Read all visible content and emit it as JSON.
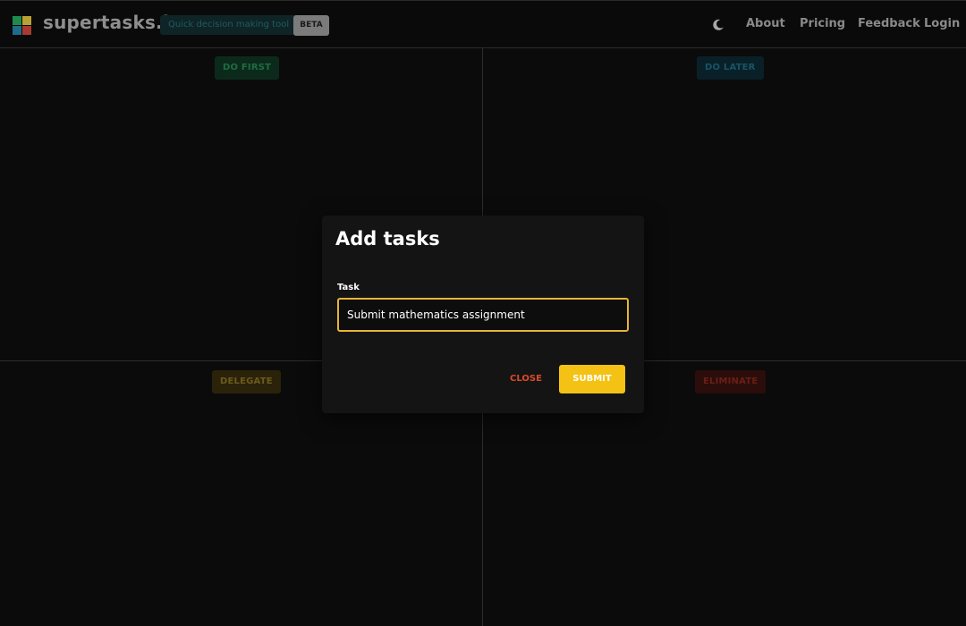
{
  "header": {
    "brand": "supertasks.io",
    "tagline": "Quick decision making tool",
    "beta_label": "BETA",
    "theme_icon": "moon-icon",
    "nav": {
      "about": "About",
      "pricing": "Pricing",
      "feedback": "Feedback",
      "login": "Login"
    },
    "logo_colors": [
      "#1f8a4e",
      "#b9a233",
      "#1f6b8a",
      "#a83b2f"
    ]
  },
  "quadrants": {
    "do_first": "DO FIRST",
    "do_later": "DO LATER",
    "delegate": "DELEGATE",
    "eliminate": "ELIMINATE"
  },
  "modal": {
    "title": "Add tasks",
    "task_label": "Task",
    "task_value": "Submit mathematics assignment",
    "close_label": "CLOSE",
    "submit_label": "SUBMIT",
    "accent_color": "#f3c214"
  }
}
